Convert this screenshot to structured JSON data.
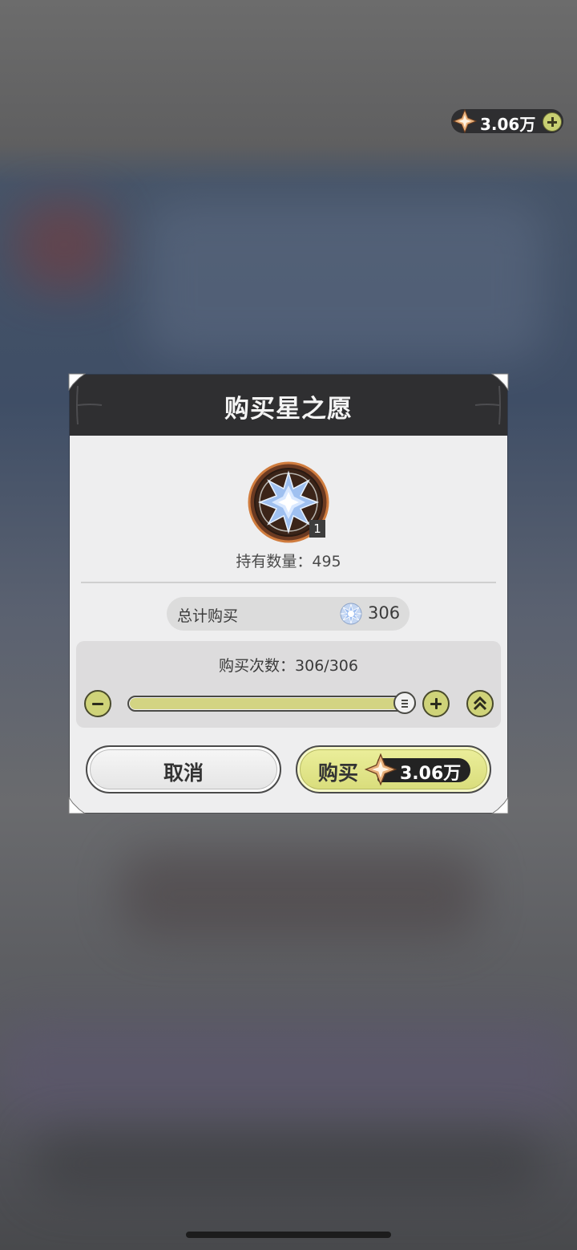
{
  "top_bar": {
    "currency_amount": "3.06万"
  },
  "dialog": {
    "title": "购买星之愿",
    "item_badge": "1",
    "owned_text": "持有数量：495",
    "total_label": "总计购买",
    "total_value": "306",
    "quantity_text": "购买次数：306/306",
    "quantity_fraction": 1.0,
    "cancel_label": "取消",
    "buy_label": "购买",
    "buy_price": "3.06万"
  },
  "colors": {
    "accent_yellow": "#d3d483",
    "header_dark": "#2f2f31",
    "panel_light": "#eeeeef"
  },
  "icons": {
    "currency": "star-crystal-icon",
    "item": "wish-star-icon"
  }
}
